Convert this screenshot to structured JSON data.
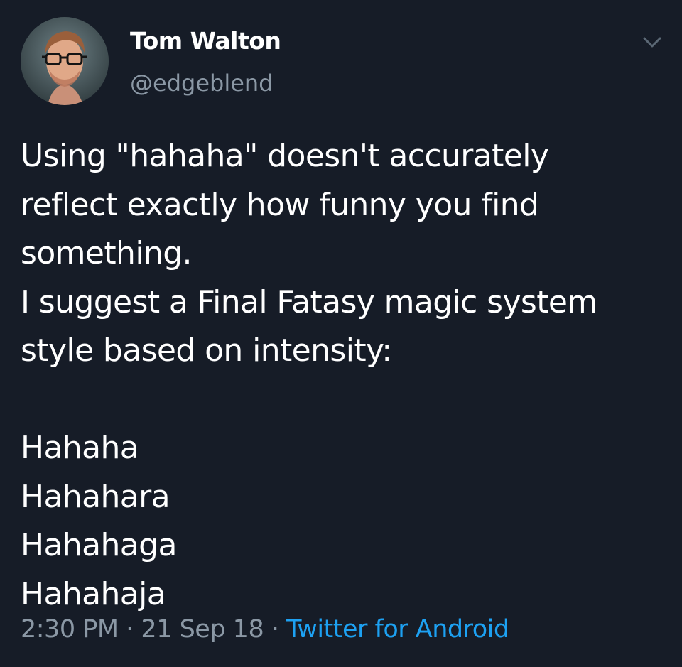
{
  "author": {
    "display_name": "Tom Walton",
    "handle": "@edgeblend",
    "avatar_icon": "profile-photo"
  },
  "menu": {
    "icon": "chevron-down-icon"
  },
  "tweet": {
    "lines": [
      "Using \"hahaha\" doesn't accurately",
      "reflect exactly how funny you find",
      "something.",
      "I suggest a Final Fatasy magic system",
      "style based on intensity:"
    ],
    "list": [
      "Hahaha",
      "Hahahara",
      "Hahahaga",
      "Hahahaja"
    ]
  },
  "meta": {
    "time": "2:30 PM",
    "separator": " · ",
    "date": "21 Sep 18",
    "source": "Twitter for Android"
  },
  "colors": {
    "background": "#161c27",
    "text": "#ffffff",
    "secondary_text": "#8b98a5",
    "link": "#1da1f2"
  }
}
